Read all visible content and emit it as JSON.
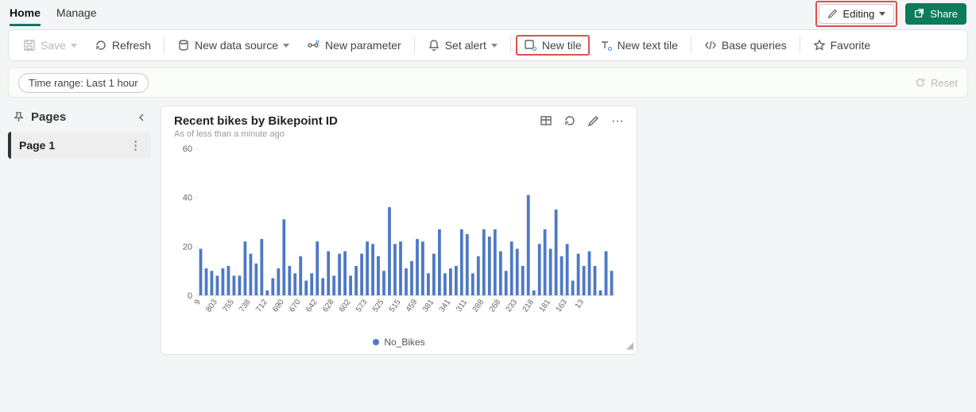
{
  "nav": {
    "tabs": [
      "Home",
      "Manage"
    ],
    "active": 0
  },
  "topbar": {
    "editing": "Editing",
    "share": "Share"
  },
  "toolbar": {
    "save": "Save",
    "refresh": "Refresh",
    "newDataSource": "New data source",
    "newParameter": "New parameter",
    "setAlert": "Set alert",
    "newTile": "New tile",
    "newTextTile": "New text tile",
    "baseQueries": "Base queries",
    "favorite": "Favorite"
  },
  "filter": {
    "timeRange": "Time range: Last 1 hour",
    "reset": "Reset"
  },
  "sidebar": {
    "title": "Pages",
    "items": [
      {
        "label": "Page 1"
      }
    ]
  },
  "tile": {
    "title": "Recent bikes by Bikepoint ID",
    "subtitle": "As of less than a minute ago",
    "legend": "No_Bikes"
  },
  "chart_data": {
    "type": "bar",
    "categories": [
      "9",
      "",
      "",
      "803",
      "",
      "",
      "755",
      "",
      "",
      "738",
      "",
      "",
      "712",
      "",
      "",
      "690",
      "",
      "",
      "670",
      "",
      "",
      "642",
      "",
      "",
      "628",
      "",
      "",
      "602",
      "",
      "",
      "573",
      "",
      "",
      "525",
      "",
      "",
      "515",
      "",
      "",
      "459",
      "",
      "",
      "381",
      "",
      "",
      "341",
      "",
      "",
      "311",
      "",
      "",
      "288",
      "",
      "",
      "268",
      "",
      "",
      "233",
      "",
      "",
      "218",
      "",
      "",
      "181",
      "",
      "",
      "163",
      "",
      "",
      "13",
      "",
      ""
    ],
    "values": [
      19,
      11,
      10,
      8,
      11,
      12,
      8,
      8,
      22,
      17,
      13,
      23,
      2,
      7,
      11,
      31,
      12,
      9,
      16,
      6,
      9,
      22,
      7,
      18,
      8,
      17,
      18,
      8,
      12,
      17,
      22,
      21,
      16,
      10,
      36,
      21,
      22,
      11,
      14,
      23,
      22,
      9,
      17,
      27,
      9,
      11,
      12,
      27,
      25,
      9,
      16,
      27,
      24,
      27,
      18,
      10,
      22,
      19,
      12,
      41,
      2,
      21,
      27,
      19,
      35,
      16,
      21,
      6,
      17,
      12,
      18,
      12,
      2,
      18,
      10
    ],
    "ylabel": "",
    "xlabel": "",
    "ylim": [
      0,
      60
    ],
    "yticks": [
      0,
      20,
      40,
      60
    ],
    "title": "Recent bikes by Bikepoint ID",
    "legend": [
      "No_Bikes"
    ],
    "colors": {
      "bars": "#4e79c4"
    }
  }
}
